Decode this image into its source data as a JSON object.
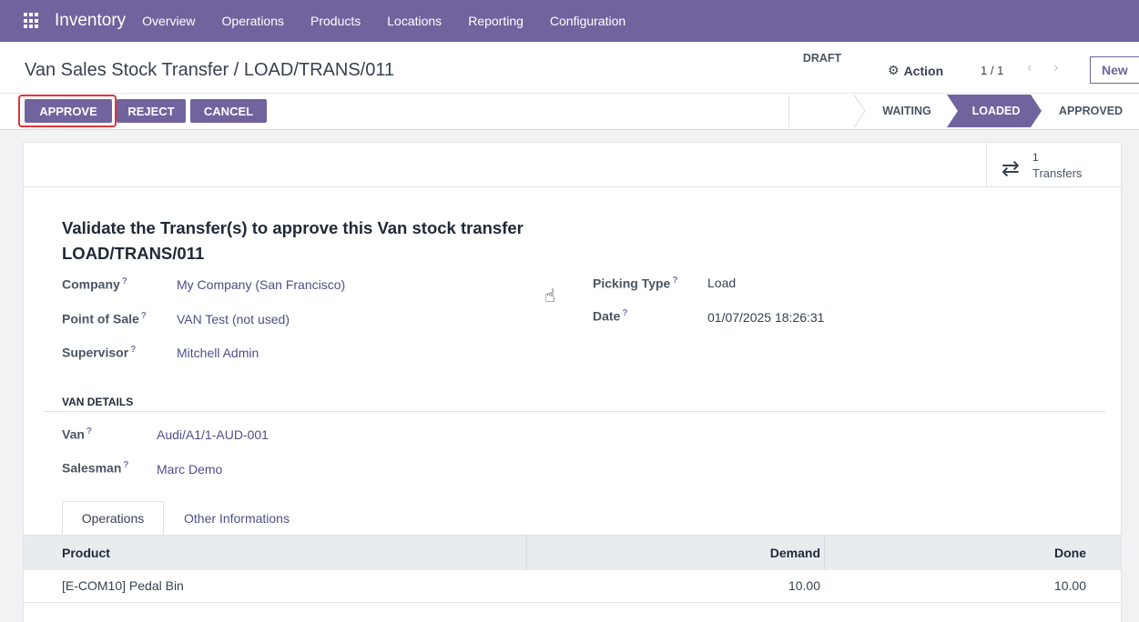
{
  "navbar": {
    "app_name": "Inventory",
    "menu": [
      "Overview",
      "Operations",
      "Products",
      "Locations",
      "Reporting",
      "Configuration"
    ]
  },
  "control_panel": {
    "breadcrumb": "Van Sales Stock Transfer / LOAD/TRANS/011",
    "action_label": "Action",
    "pager": "1 / 1",
    "new_label": "New",
    "buttons": {
      "approve": "APPROVE",
      "reject": "REJECT",
      "cancel": "CANCEL"
    },
    "stages": [
      "DRAFT",
      "WAITING",
      "LOADED",
      "APPROVED"
    ],
    "active_stage": "LOADED"
  },
  "smart_button": {
    "value": "1",
    "label": "Transfers"
  },
  "form": {
    "title": "Validate the Transfer(s) to approve this Van stock transfer LOAD/TRANS/011",
    "fields": {
      "company": {
        "label": "Company",
        "value": "My Company (San Francisco)"
      },
      "point_of_sale": {
        "label": "Point of Sale",
        "value": "VAN Test (not used)"
      },
      "supervisor": {
        "label": "Supervisor",
        "value": "Mitchell Admin"
      },
      "picking_type": {
        "label": "Picking Type",
        "value": "Load"
      },
      "date": {
        "label": "Date",
        "value": "01/07/2025 18:26:31"
      }
    },
    "van_section": {
      "title": "VAN DETAILS",
      "van": {
        "label": "Van",
        "value": "Audi/A1/1-AUD-001"
      },
      "salesman": {
        "label": "Salesman",
        "value": "Marc Demo"
      }
    },
    "tabs": [
      "Operations",
      "Other Informations"
    ],
    "table": {
      "columns": [
        "Product",
        "Demand",
        "Done"
      ],
      "rows": [
        {
          "product": "[E-COM10] Pedal Bin",
          "demand": "10.00",
          "done": "10.00"
        }
      ]
    },
    "help_mark": "?"
  },
  "colors": {
    "primary": "#71639e",
    "highlight": "#e0353b"
  }
}
